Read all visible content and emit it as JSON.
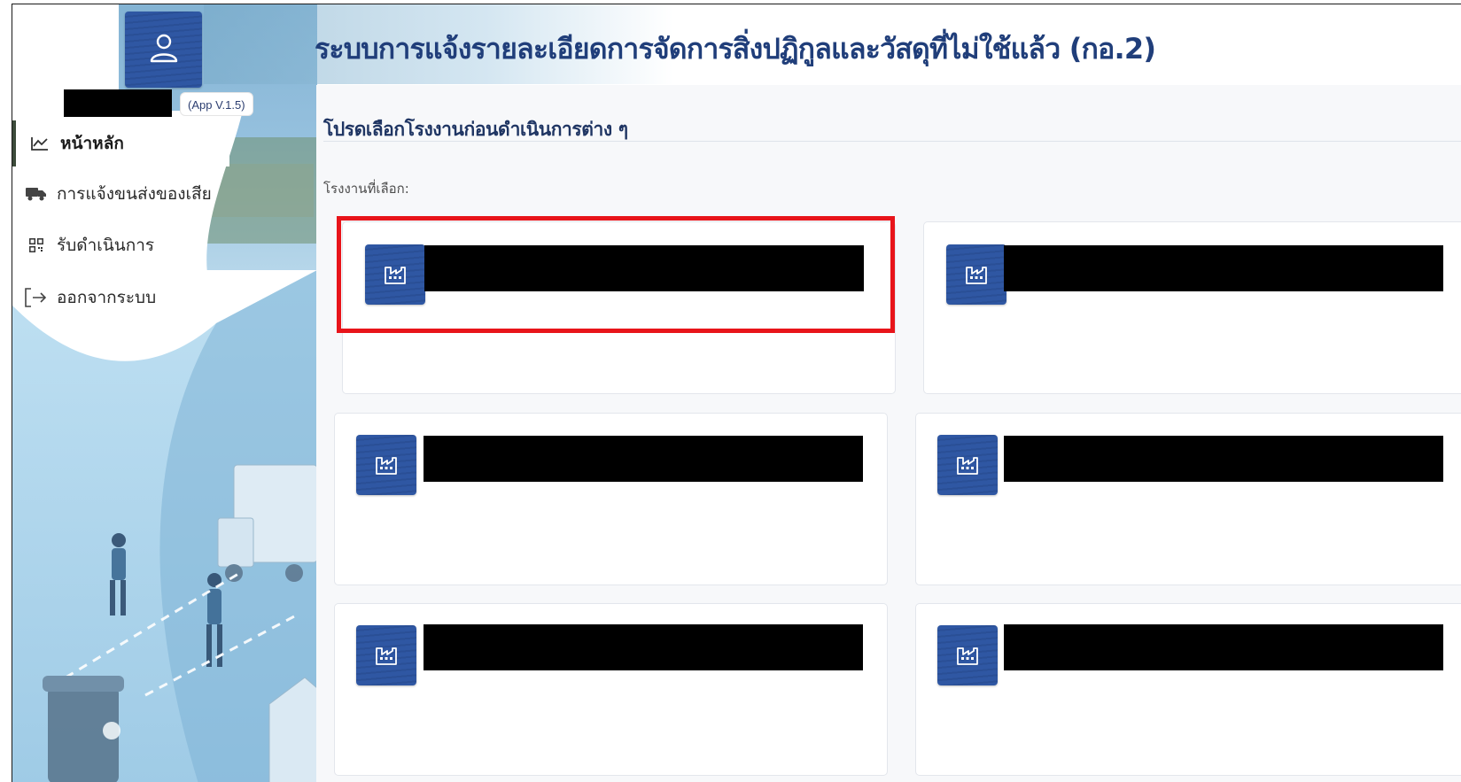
{
  "header": {
    "title": "ระบบการแจ้งรายละเอียดการจัดการสิ่งปฏิกูลและวัสดุที่ไม่ใช้แล้ว (กอ.2)"
  },
  "user": {
    "avatar_icon": "user-icon",
    "name": "",
    "app_version": "(App V.1.5)"
  },
  "sidebar": {
    "items": [
      {
        "label": "หน้าหลัก",
        "icon": "chart-line-icon",
        "active": true
      },
      {
        "label": "การแจ้งขนส่งของเสีย",
        "icon": "truck-icon",
        "active": false
      },
      {
        "label": "รับดำเนินการ",
        "icon": "qr-code-icon",
        "active": false
      },
      {
        "label": "ออกจากระบบ",
        "icon": "logout-icon",
        "active": false
      }
    ]
  },
  "main": {
    "section_title": "โปรดเลือกโรงงานก่อนดำเนินการต่าง ๆ",
    "selected_label": "โรงงานที่เลือก:",
    "factories": [
      {
        "icon": "factory-icon",
        "name": "",
        "highlighted": true
      },
      {
        "icon": "factory-icon",
        "name": "",
        "highlighted": false
      },
      {
        "icon": "factory-icon",
        "name": "",
        "highlighted": false
      },
      {
        "icon": "factory-icon",
        "name": "",
        "highlighted": false
      },
      {
        "icon": "factory-icon",
        "name": "",
        "highlighted": false
      },
      {
        "icon": "factory-icon",
        "name": "",
        "highlighted": false
      }
    ]
  },
  "colors": {
    "title": "#203e7a",
    "accent_blue": "#2f57a3",
    "highlight": "#e8141a",
    "content_bg": "#f7f8fa"
  }
}
